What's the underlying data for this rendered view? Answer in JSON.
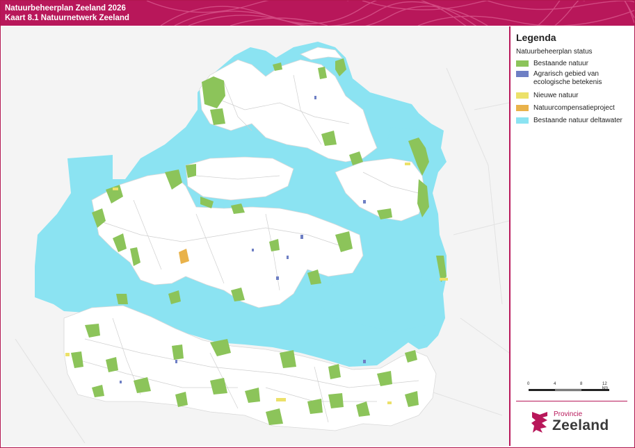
{
  "header": {
    "line1": "Natuurbeheerplan Zeeland 2026",
    "line2": "Kaart 8.1 Natuurnetwerk Zeeland"
  },
  "legend": {
    "title": "Legenda",
    "subtitle": "Natuurbeheerplan status",
    "items": [
      {
        "label": "Bestaande natuur",
        "color": "#8cc45a",
        "icon": "swatch-green"
      },
      {
        "label": "Agrarisch gebied van ecologische betekenis",
        "color": "#6e7fc4",
        "icon": "swatch-blue"
      },
      {
        "label": "Nieuwe natuur",
        "color": "#ece16a",
        "icon": "swatch-yellow"
      },
      {
        "label": "Natuurcompensatieproject",
        "color": "#e9b24a",
        "icon": "swatch-orange"
      },
      {
        "label": "Bestaande natuur deltawater",
        "color": "#8be3f2",
        "icon": "swatch-cyan"
      }
    ]
  },
  "scale": {
    "ticks": [
      "0",
      "4",
      "8",
      "12 km"
    ]
  },
  "logo": {
    "provincie": "Provincie",
    "zeeland": "Zeeland"
  },
  "colors": {
    "brand": "#b8175a",
    "water": "#8be3f2",
    "land": "#ffffff",
    "background": "#f4f4f4"
  }
}
